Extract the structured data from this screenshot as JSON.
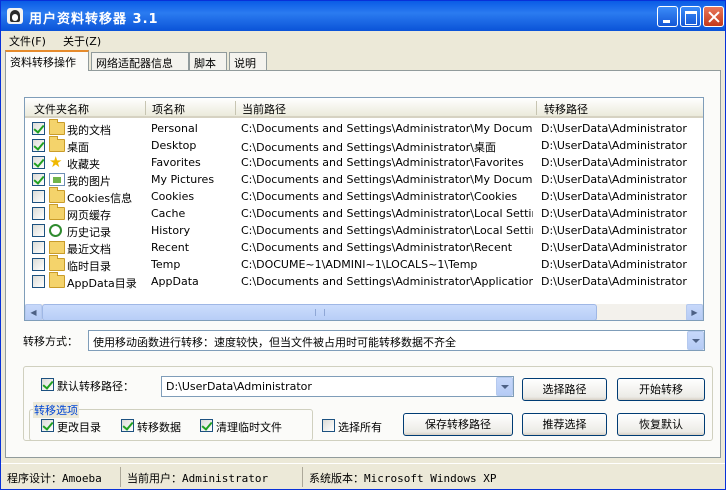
{
  "window": {
    "title": "用户资料转移器  3.1"
  },
  "menu": [
    "文件(F)",
    "关于(Z)"
  ],
  "tabs": [
    "资料转移操作",
    "网络适配器信息",
    "脚本",
    "说明"
  ],
  "list": {
    "columns": [
      "文件夹名称",
      "项名称",
      "当前路径",
      "转移路径"
    ],
    "rows": [
      {
        "checked": true,
        "icon": "folder-icon",
        "name": "我的文档",
        "item": "Personal",
        "current": "C:\\Documents and Settings\\Administrator\\My Documents",
        "target": "D:\\UserData\\Administrator"
      },
      {
        "checked": true,
        "icon": "folder-icon",
        "name": "桌面",
        "item": "Desktop",
        "current": "C:\\Documents and Settings\\Administrator\\桌面",
        "target": "D:\\UserData\\Administrator"
      },
      {
        "checked": true,
        "icon": "star-icon",
        "name": "收藏夹",
        "item": "Favorites",
        "current": "C:\\Documents and Settings\\Administrator\\Favorites",
        "target": "D:\\UserData\\Administrator"
      },
      {
        "checked": true,
        "icon": "picture-icon",
        "name": "我的图片",
        "item": "My Pictures",
        "current": "C:\\Documents and Settings\\Administrator\\My Documents...",
        "target": "D:\\UserData\\Administrator"
      },
      {
        "checked": false,
        "icon": "folder-icon",
        "name": "Cookies信息",
        "item": "Cookies",
        "current": "C:\\Documents and Settings\\Administrator\\Cookies",
        "target": "D:\\UserData\\Administrator"
      },
      {
        "checked": false,
        "icon": "folder-icon",
        "name": "网页缓存",
        "item": "Cache",
        "current": "C:\\Documents and Settings\\Administrator\\Local Settings\\...",
        "target": "D:\\UserData\\Administrator"
      },
      {
        "checked": false,
        "icon": "history-icon",
        "name": "历史记录",
        "item": "History",
        "current": "C:\\Documents and Settings\\Administrator\\Local Settings\\...",
        "target": "D:\\UserData\\Administrator"
      },
      {
        "checked": false,
        "icon": "recent-icon",
        "name": "最近文档",
        "item": "Recent",
        "current": "C:\\Documents and Settings\\Administrator\\Recent",
        "target": "D:\\UserData\\Administrator"
      },
      {
        "checked": false,
        "icon": "folder-icon",
        "name": "临时目录",
        "item": "Temp",
        "current": "C:\\DOCUME~1\\ADMINI~1\\LOCALS~1\\Temp",
        "target": "D:\\UserData\\Administrator"
      },
      {
        "checked": false,
        "icon": "folder-icon",
        "name": "AppData目录",
        "item": "AppData",
        "current": "C:\\Documents and Settings\\Administrator\\Application Data",
        "target": "D:\\UserData\\Administrator"
      }
    ]
  },
  "mode": {
    "label": "转移方式：",
    "value": "使用移动函数进行转移：速度较快，但当文件被占用时可能转移数据不齐全"
  },
  "default_path": {
    "label": "默认转移路径：",
    "checked": true,
    "value": "D:\\UserData\\Administrator"
  },
  "buttons": {
    "choose_path": "选择路径",
    "start": "开始转移",
    "save_path": "保存转移路径",
    "recommend": "推荐选择",
    "restore": "恢复默认"
  },
  "options": {
    "legend": "转移选项",
    "change_dir": "更改目录",
    "transfer_data": "转移数据",
    "clean_temp": "清理临时文件",
    "select_all": "选择所有"
  },
  "status": {
    "designer": "程序设计：Amoeba",
    "user": "当前用户：Administrator",
    "version": "系统版本：Microsoft Windows XP"
  }
}
